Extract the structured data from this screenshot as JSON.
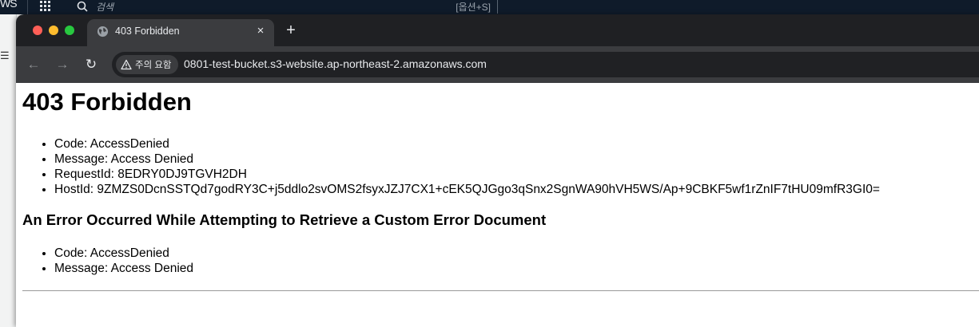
{
  "aws_console": {
    "logo_text": "WS",
    "search_placeholder": "검색",
    "search_shortcut": "[옵션+S]",
    "side_menu_glyph": "☰"
  },
  "browser": {
    "tab": {
      "title": "403 Forbidden",
      "close_glyph": "×"
    },
    "new_tab_glyph": "+",
    "toolbar": {
      "back_glyph": "←",
      "forward_glyph": "→",
      "reload_glyph": "↻",
      "security_label": "주의 요함",
      "url": "0801-test-bucket.s3-website.ap-northeast-2.amazonaws.com"
    }
  },
  "page": {
    "title": "403 Forbidden",
    "error_items": [
      "Code: AccessDenied",
      "Message: Access Denied",
      "RequestId: 8EDRY0DJ9TGVH2DH",
      "HostId: 9ZMZS0DcnSSTQd7godRY3C+j5ddlo2svOMS2fsyxJZJ7CX1+cEK5QJGgo3qSnx2SgnWA90hVH5WS/Ap+9CBKF5wf1rZnIF7tHU09mfR3GI0="
    ],
    "custom_error_heading": "An Error Occurred While Attempting to Retrieve a Custom Error Document",
    "custom_error_items": [
      "Code: AccessDenied",
      "Message: Access Denied"
    ]
  }
}
